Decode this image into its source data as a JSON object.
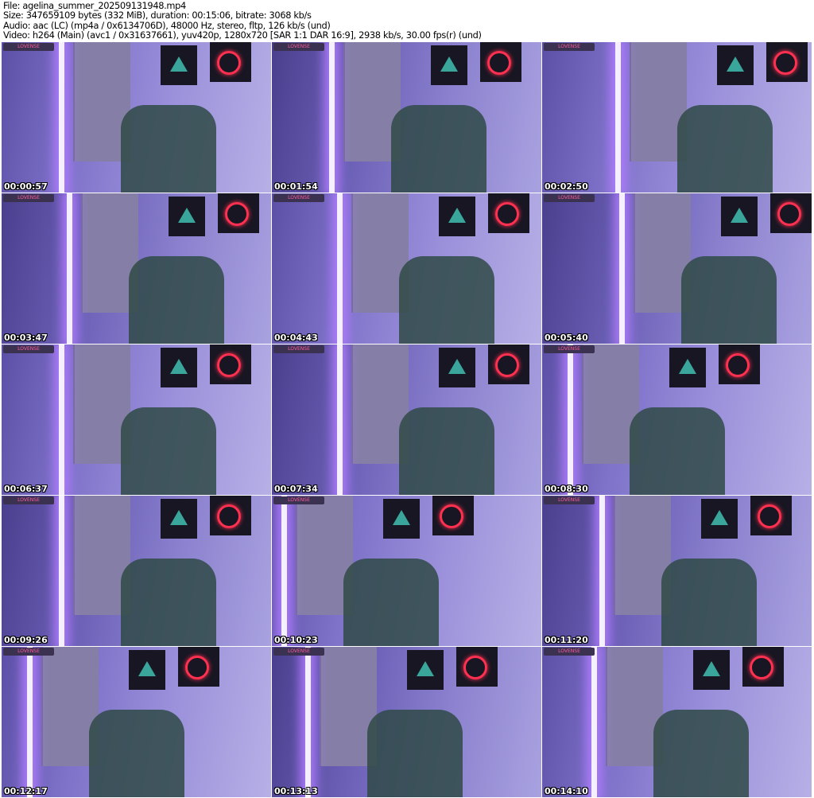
{
  "header": {
    "file": "File: agelina_summer_202509131948.mp4",
    "size": "Size: 347659109 bytes (332 MiB), duration: 00:15:06, bitrate: 3068 kb/s",
    "audio": "Audio: aac (LC) (mp4a / 0x6134706D), 48000 Hz, stereo, fltp, 126 kb/s (und)",
    "video": "Video: h264 (Main) (avc1 / 0x31637661), yuv420p, 1280x720 [SAR 1:1 DAR 16:9], 2938 kb/s, 30.00 fps(r) (und)"
  },
  "watermark": "LOVENSE",
  "thumbnails": [
    "00:00:57",
    "00:01:54",
    "00:02:50",
    "00:03:47",
    "00:04:43",
    "00:05:40",
    "00:06:37",
    "00:07:34",
    "00:08:30",
    "00:09:26",
    "00:10:23",
    "00:11:20",
    "00:12:17",
    "00:13:13",
    "00:14:10"
  ]
}
